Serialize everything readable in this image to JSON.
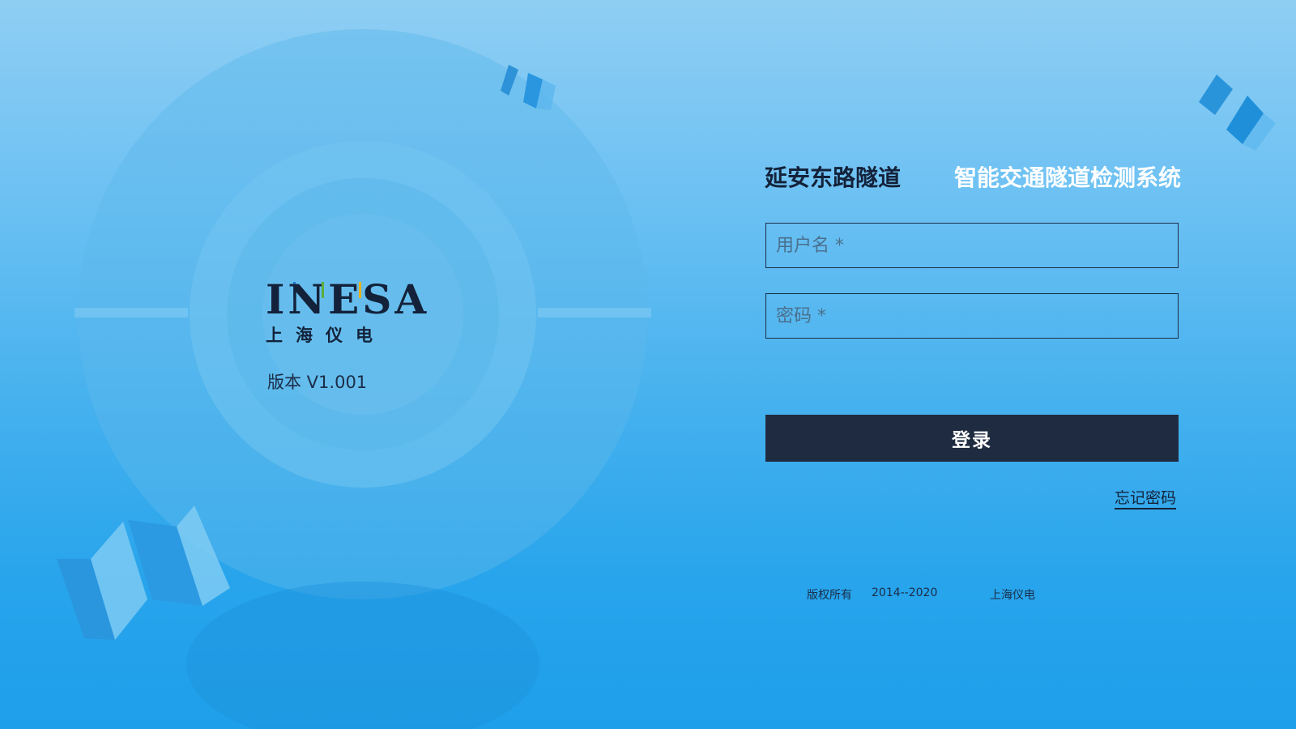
{
  "brand": {
    "logo_word": "INESA",
    "logo_cn": "上海仪电",
    "version": "版本 V1.001"
  },
  "header": {
    "title_left": "延安东路隧道",
    "title_right": "智能交通隧道检测系统"
  },
  "form": {
    "username_placeholder": "用户名 *",
    "username_value": "",
    "password_placeholder": "密码 *",
    "password_value": "",
    "login_label": "登录",
    "forgot_label": "忘记密码"
  },
  "footer": {
    "copyright": "版权所有",
    "years": "2014--2020",
    "company": "上海仪电"
  },
  "colors": {
    "dark_navy": "#1e2b40",
    "text_dark": "#13223a",
    "bg_light": "#8fcef3",
    "bg_deep": "#1e9fe9",
    "tick_blue": "#1e74c8",
    "tick_green": "#5cae3a",
    "tick_yellow": "#e7b21a"
  }
}
